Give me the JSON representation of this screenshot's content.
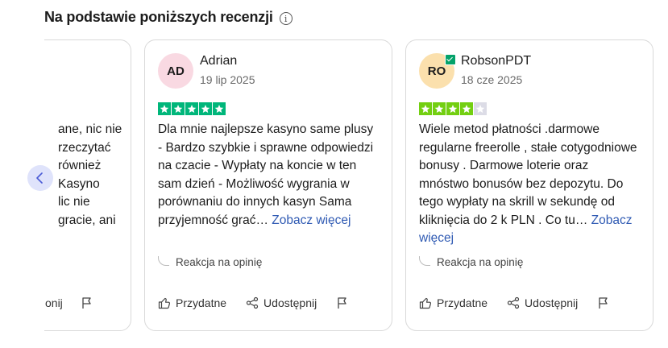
{
  "heading": {
    "title": "Na podstawie poniższych recenzji",
    "info_icon": "info-icon"
  },
  "colors": {
    "star_green": "#00b67a",
    "star_lightgreen": "#73cf11",
    "star_empty": "#dcdce6",
    "link": "#2f5ab3",
    "prev_bg": "#dfe3fb"
  },
  "reviews": [
    {
      "text_lines": [
        "ane, nic nie",
        "rzeczytać",
        "również",
        "Kasyno",
        "lic nie",
        "gracie, ani"
      ],
      "actions": {
        "share_partial": "onij"
      }
    },
    {
      "initials": "AD",
      "avatar_color": "#f9d9e2",
      "name": "Adrian",
      "date": "19 lip 2025",
      "rating": 5,
      "star_color": "#00b67a",
      "text": "Dla mnie najlepsze kasyno same plusy - Bardzo szybkie i sprawne odpowiedzi na czacie - Wypłaty na koncie w ten sam dzień - Możliwość wygrania w porównaniu do innych kasyn Sama przyjemność grać…",
      "see_more": "Zobacz więcej",
      "reaction": "Reakcja na opinię",
      "actions": {
        "useful": "Przydatne",
        "share": "Udostępnij"
      }
    },
    {
      "initials": "RO",
      "avatar_color": "#fbe0ad",
      "verified": true,
      "name": "RobsonPDT",
      "date": "18 cze 2025",
      "rating": 4,
      "star_color": "#73cf11",
      "text": "Wiele metod płatności .darmowe regularne freerolle , stałe cotygodniowe bonusy . Darmowe loterie oraz mnóstwo bonusów bez depozytu. Do tego wypłaty na skrill w sekundę od kliknięcia do 2 k PLN . Co tu…",
      "see_more": "Zobacz więcej",
      "reaction": "Reakcja na opinię",
      "actions": {
        "useful": "Przydatne",
        "share": "Udostępnij"
      }
    }
  ]
}
